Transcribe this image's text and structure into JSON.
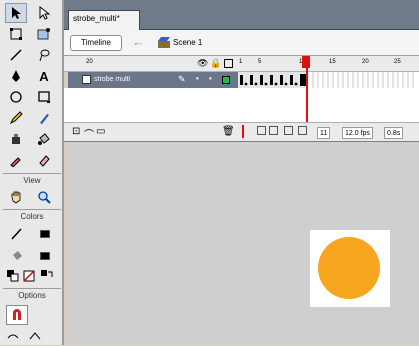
{
  "document": {
    "tab_title": "strobe_multi*"
  },
  "edit_bar": {
    "timeline_label": "Timeline",
    "scene_label": "Scene 1"
  },
  "toolbox": {
    "view_label": "View",
    "colors_label": "Colors",
    "options_label": "Options"
  },
  "timeline": {
    "ruler_numbers": [
      "1",
      "5",
      "10",
      "15",
      "20",
      "25"
    ],
    "layer_name": "strobe multi",
    "current_frame": "11",
    "frame_rate": "12.0 fps",
    "elapsed": "0.8s",
    "layer_header_number": "20"
  },
  "stage": {
    "shape_color": "#f8a520"
  },
  "colors": {
    "layer_row": "#6b768a",
    "playhead": "#e01010"
  }
}
